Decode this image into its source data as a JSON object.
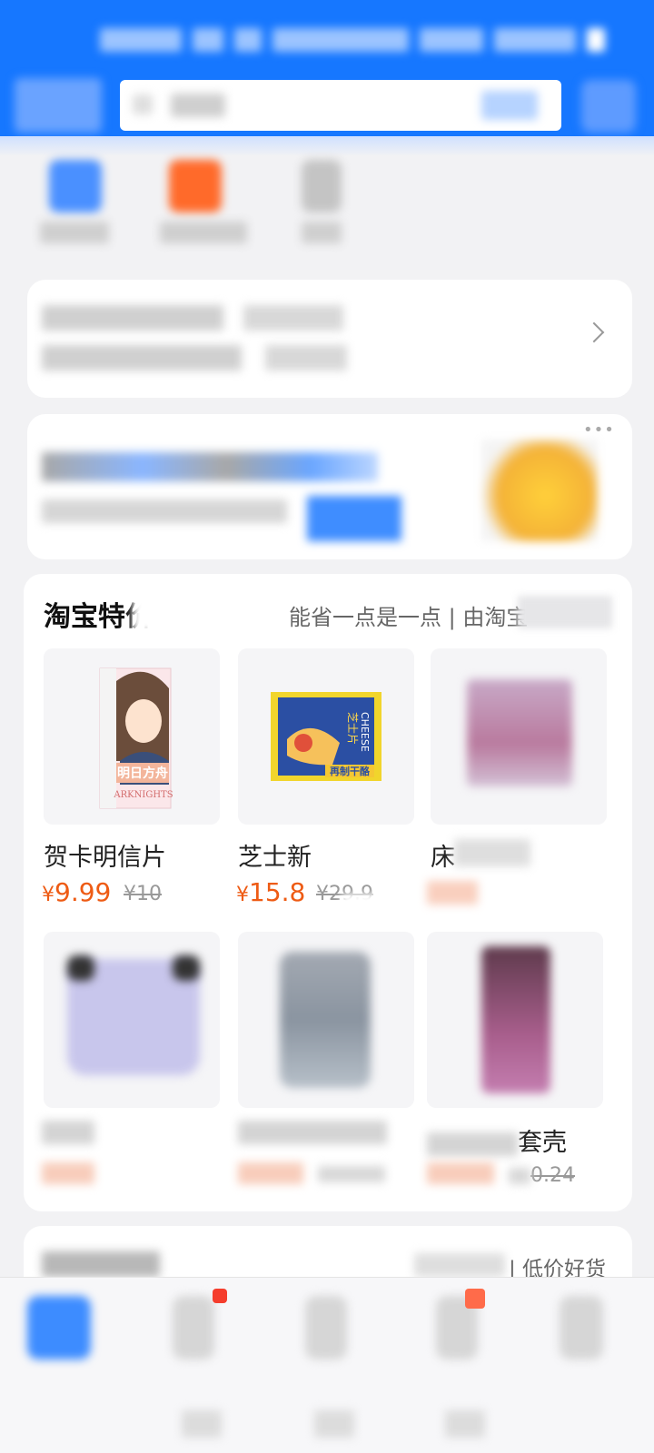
{
  "header": {
    "accent_color": "#1677ff",
    "search_icon": "search-icon",
    "scan_icon": "scan-icon"
  },
  "shortcuts": [
    {
      "icon": "blue-service-icon",
      "color": "#2f7dff"
    },
    {
      "icon": "orange-service-icon",
      "color": "#ff6a2a"
    },
    {
      "icon": "grey-service-icon",
      "color": "#b9b9b9"
    }
  ],
  "taobao": {
    "title": "淘宝特价",
    "subtitle": "能省一点是一点 | 由淘宝",
    "products": [
      {
        "name": "贺卡明信片",
        "price": "9.99",
        "old_price": "¥10",
        "currency": "¥"
      },
      {
        "name": "芝士新",
        "price": "15.8",
        "old_price": "¥29.9",
        "currency": "¥"
      }
    ],
    "partial_texts": {
      "third_name_start": "床",
      "row2_third_name_end": "套壳",
      "row2_third_old_price_end": "0.24"
    }
  },
  "next_section": {
    "subtitle": "| 低价好货"
  },
  "bottom_nav": {
    "home_color": "#3d8cff",
    "badge_color": "#f53d2d"
  },
  "product_images": {
    "card": {
      "brand": "明日方舟",
      "en": "ARKNIGHTS"
    },
    "cheese": {
      "title": "芝士片",
      "en": "CHEESE",
      "bottom": "再制干酪"
    }
  }
}
